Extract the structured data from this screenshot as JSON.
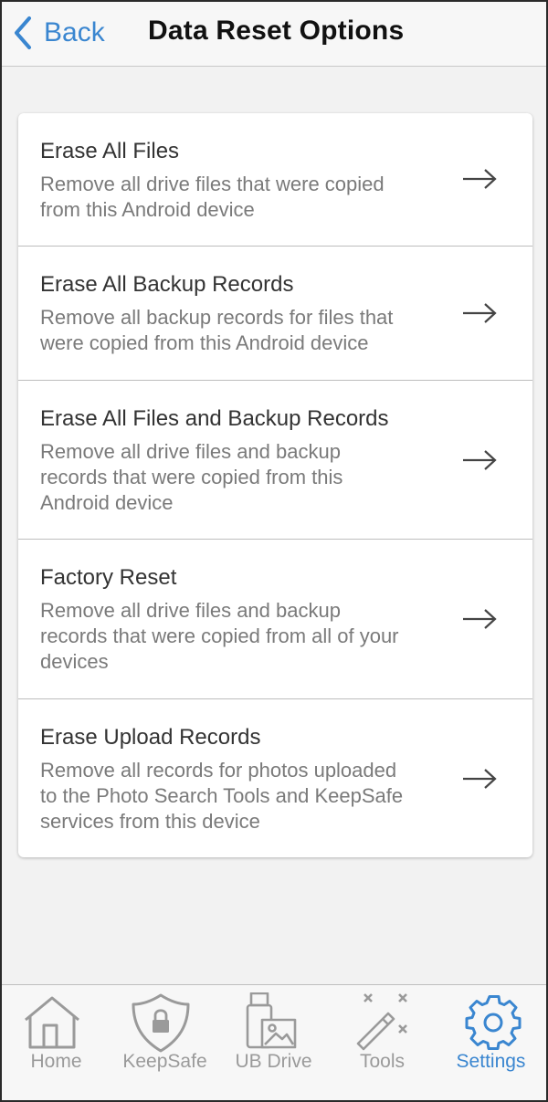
{
  "header": {
    "back_label": "Back",
    "title": "Data Reset Options"
  },
  "options": [
    {
      "title": "Erase All Files",
      "desc_lines": [
        "Remove all drive files that were copied",
        "from this Android device"
      ]
    },
    {
      "title": "Erase All Backup Records",
      "desc_lines": [
        "Remove all backup records for files that",
        "were copied from this Android device"
      ]
    },
    {
      "title": "Erase All Files and Backup Records",
      "desc_lines": [
        "Remove all drive files and backup",
        "records that were copied from this",
        "Android device"
      ]
    },
    {
      "title": "Factory Reset",
      "desc_lines": [
        "Remove all drive files and backup",
        "records that were copied from all of your",
        "devices"
      ]
    },
    {
      "title": "Erase Upload Records",
      "desc_lines": [
        "Remove all records for photos uploaded",
        "to the Photo Search Tools and KeepSafe",
        "services from this device"
      ]
    }
  ],
  "tabs": [
    {
      "label": "Home",
      "icon": "home-icon"
    },
    {
      "label": "KeepSafe",
      "icon": "shield-lock-icon"
    },
    {
      "label": "UB Drive",
      "icon": "usb-drive-icon"
    },
    {
      "label": "Tools",
      "icon": "magic-wand-icon"
    },
    {
      "label": "Settings",
      "icon": "gear-icon"
    }
  ],
  "active_tab": "Settings",
  "colors": {
    "accent": "#3a86d0",
    "inactive": "#9a9a9a",
    "title_text": "#333333",
    "desc_text": "#7a7a7a"
  }
}
